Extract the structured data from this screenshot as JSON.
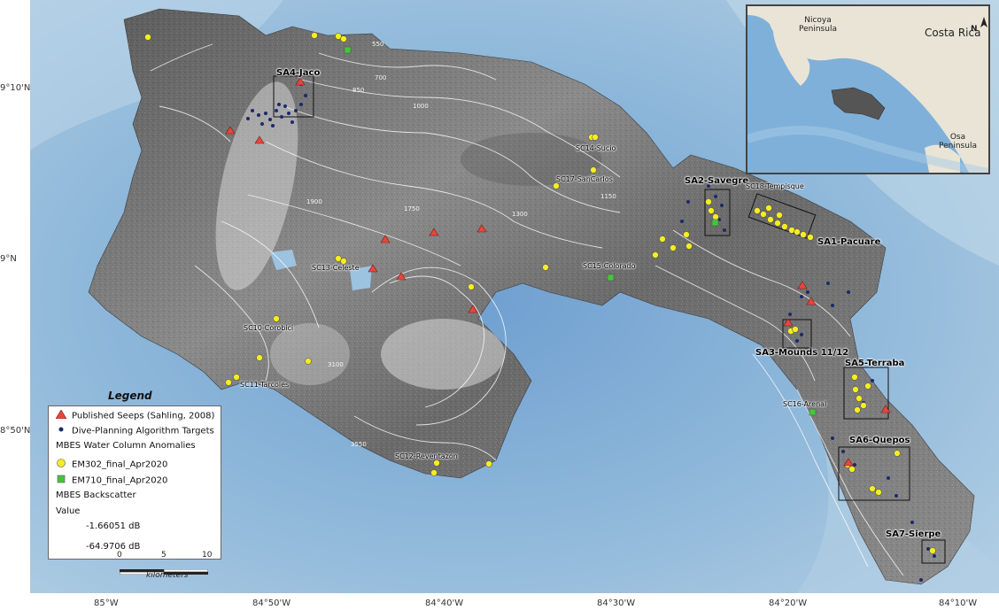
{
  "axes": {
    "left_ticks": [
      "9°10'N",
      "9°N",
      "8°50'N"
    ],
    "bottom_ticks": [
      "85°W",
      "84°50'W",
      "84°40'W",
      "84°30'W",
      "84°20'W",
      "84°10'W"
    ]
  },
  "labels": {
    "sa4": "SA4-Jaco",
    "sa2": "SA2-Savegre",
    "sa1": "SA1-Pacuare",
    "sa3": "SA3-Mounds 11/12",
    "sa5": "SA5-Terraba",
    "sa6": "SA6-Quepos",
    "sa7": "SA7-Sierpe",
    "sc14": "SC14-Sucio",
    "sc17": "SC17-SanCarlos",
    "sc18": "SC18-Tempisque",
    "sc15": "SC15-Colorado",
    "sc13": "SC13-Celeste",
    "sc10": "SC10-Corobici",
    "sc11": "SC11-Tarcoles",
    "sc16": "SC16-Arenal",
    "sc12": "SC12-Reventazon"
  },
  "contours": [
    "550",
    "700",
    "850",
    "1000",
    "1150",
    "1300",
    "1750",
    "1900",
    "1300",
    "2500",
    "3100",
    "3550"
  ],
  "inset": {
    "nicoya": "Nicoya\nPeninsula",
    "costa_rica": "Costa Rica",
    "osa": "Osa\nPeninsula",
    "north_arrow": "N"
  },
  "legend": {
    "title": "Legend",
    "seeps": "Published Seeps (Sahling, 2008)",
    "dive": "Dive-Planning Algorithm Targets",
    "mbes_wc": "MBES Water Column Anomalies",
    "em302": "EM302_final_Apr2020",
    "em710": "EM710_final_Apr2020",
    "backscatter": "MBES Backscatter",
    "value": "Value",
    "max": "-1.66051 dB",
    "min": "-64.9706 dB"
  },
  "scale": {
    "ticks": [
      "0",
      "5",
      "10"
    ],
    "unit": "kilometers"
  },
  "colors": {
    "ocean": "#8fb8da",
    "seep": "#e8463c",
    "dive": "#1c2a6b",
    "em302": "#f6ee1d",
    "em710": "#41c83a"
  }
}
